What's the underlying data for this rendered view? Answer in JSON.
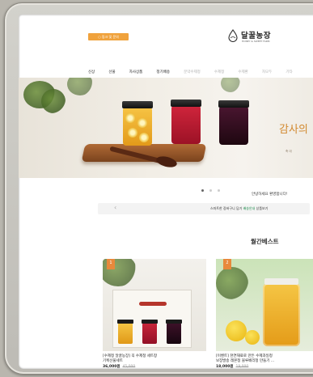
{
  "header": {
    "top_button_label": "○ 링크 및 문의",
    "logo_text": "달꿀농장",
    "logo_subtext": "HONEY & SWEET FARM"
  },
  "nav": {
    "items": [
      {
        "label": "신상"
      },
      {
        "label": "선물"
      },
      {
        "label": "자사상품"
      },
      {
        "label": "정기배송"
      },
      {
        "label": "분약수제청"
      },
      {
        "label": "수제청"
      },
      {
        "label": "수제환"
      },
      {
        "label": "자모두"
      },
      {
        "label": "기타"
      }
    ]
  },
  "hero": {
    "title": "감사의",
    "subtitle": "축 대",
    "colors": {
      "accent": "#d2892f"
    }
  },
  "notice": {
    "title": "안녕하세요 환영합니다!",
    "text_prefix": "스마트한 장바구니 담기",
    "text_highlight": "배송안내",
    "text_suffix": "상품보기",
    "prev_icon": "chevron-left-icon"
  },
  "best": {
    "title": "월간베스트",
    "products": [
      {
        "rank": "1",
        "name_line1": "[수제청 달꿀농장] 꼭 수제청 세트창",
        "name_line2": "기획선물세트",
        "price": "36,000원",
        "original_price": "45,000"
      },
      {
        "rank": "2",
        "name_line1": "[이벤트] 천연재료로 만든 수제과일청",
        "name_line2": "보장발송 레몬청 블루베리청 만들기 ...",
        "price": "18,000원",
        "original_price": "19,000"
      }
    ]
  }
}
